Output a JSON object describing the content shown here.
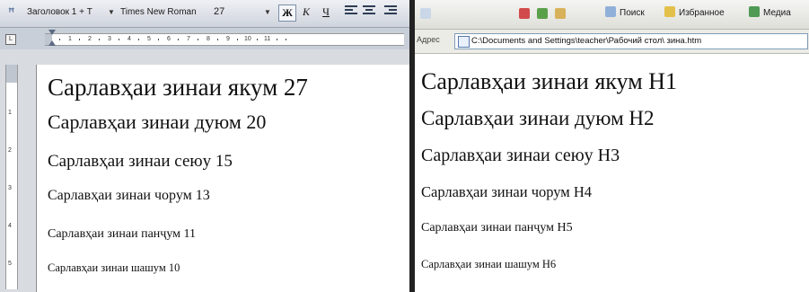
{
  "word": {
    "toolbar": {
      "style_value": "Заголовок 1 + Т",
      "font_value": "Times New Roman",
      "size_value": "27",
      "bold_label": "Ж",
      "italic_label": "К",
      "underline_label": "Ч"
    },
    "headings": [
      "Сарлавҳаи зинаи якум 27",
      "Сарлавҳаи зинаи дуюм 20",
      "Сарлавҳаи зинаи сеюу 15",
      "Сарлавҳаи зинаи чорум 13",
      "Сарлавҳаи зинаи панҷум 11",
      "Сарлавҳаи зинаи шашум 10"
    ]
  },
  "browser": {
    "toolbar": {
      "search_label": "Поиск",
      "favorites_label": "Избранное",
      "media_label": "Медиа"
    },
    "address": {
      "label": "Адрес",
      "value": "C:\\Documents and Settings\\teacher\\Рабочий стол\\ зина.htm"
    },
    "headings": [
      "Сарлавҳаи зинаи якум H1",
      "Сарлавҳаи зинаи дуюм H2",
      "Сарлавҳаи зинаи сеюу H3",
      "Сарлавҳаи зинаи чорум H4",
      "Сарлавҳаи зинаи панҷум H5",
      "Сарлавҳаи зинаи шашум H6"
    ]
  }
}
